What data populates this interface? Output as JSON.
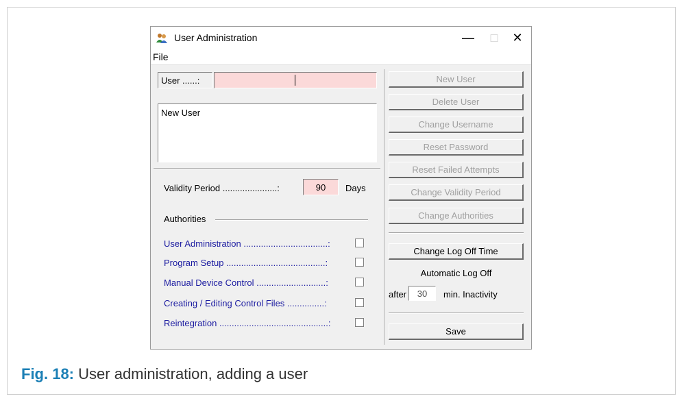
{
  "window": {
    "title": "User Administration",
    "icon": "users-icon",
    "minimize": "—",
    "maximize": "□",
    "close": "✕"
  },
  "menu": {
    "file": "File"
  },
  "user_field": {
    "label": "User ......:",
    "value": ""
  },
  "user_list": [
    "New User"
  ],
  "validity": {
    "label": "Validity Period ......................:",
    "value": "90",
    "unit": "Days"
  },
  "authorities": {
    "heading": "Authorities",
    "items": [
      {
        "label": "User Administration ..................................:",
        "checked": false
      },
      {
        "label": "Program Setup  ........................................:",
        "checked": false
      },
      {
        "label": "Manual Device Control ............................:",
        "checked": false
      },
      {
        "label": "Creating / Editing Control Files ...............:",
        "checked": false
      },
      {
        "label": "Reintegration ............................................:",
        "checked": false
      }
    ]
  },
  "buttons": {
    "new_user": "New User",
    "delete_user": "Delete User",
    "change_username": "Change Username",
    "reset_password": "Reset Password",
    "reset_failed_attempts": "Reset Failed Attempts",
    "change_validity_period": "Change Validity Period",
    "change_authorities": "Change Authorities",
    "change_log_off_time": "Change Log Off Time",
    "save": "Save"
  },
  "auto_log_off": {
    "heading": "Automatic Log Off",
    "prefix": "after",
    "value": "30",
    "suffix": "min. Inactivity"
  },
  "caption": {
    "fig": "Fig. 18:",
    "text": "User administration, adding a user"
  },
  "colors": {
    "input_highlight": "#fbd9d9",
    "caption_fig": "#1b7fb5",
    "authority_label": "#1a1aa0"
  }
}
